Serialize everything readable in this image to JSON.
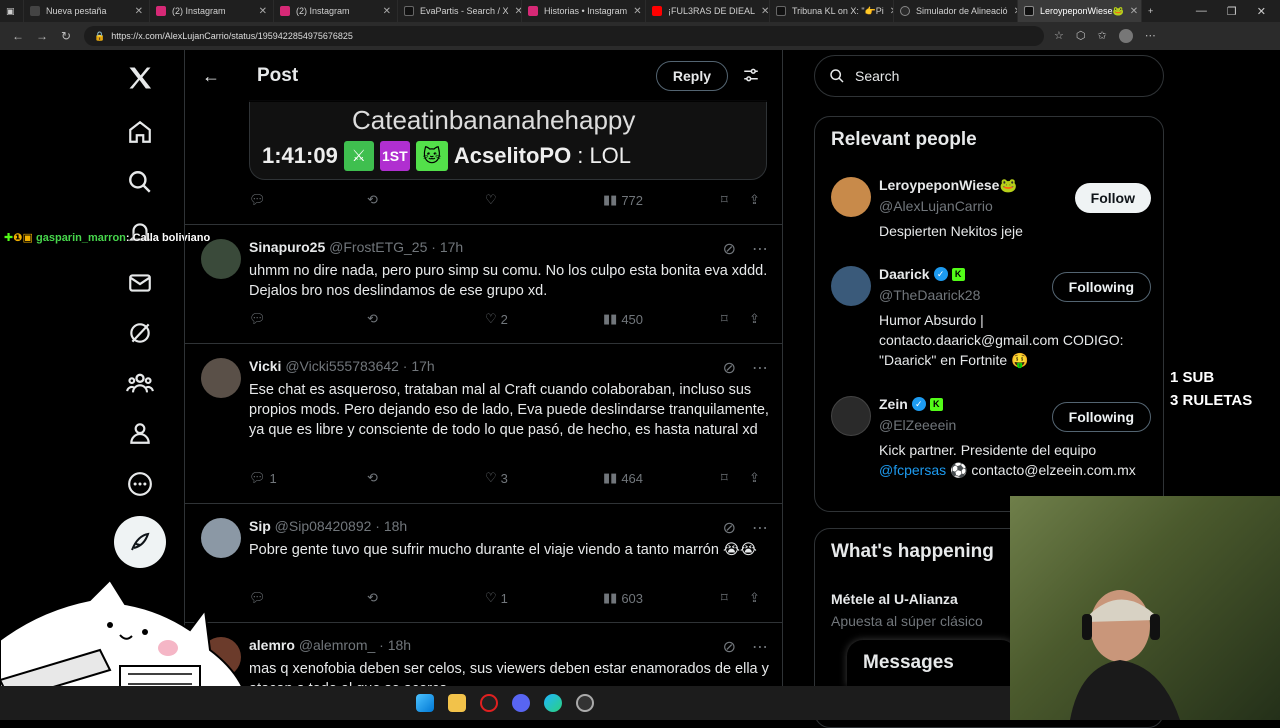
{
  "browser": {
    "tabs": [
      {
        "title": "Nueva pestaña",
        "color": "#444"
      },
      {
        "title": "(2) Instagram",
        "color": "#d62976"
      },
      {
        "title": "(2) Instagram",
        "color": "#d62976"
      },
      {
        "title": "EvaPartis - Search / X",
        "color": "#111"
      },
      {
        "title": "Historias • Instagram",
        "color": "#d62976"
      },
      {
        "title": "¡FUL3RAS DE DIEAL",
        "color": "#ff0000"
      },
      {
        "title": "Tribuna KL on X: \"👉Pi",
        "color": "#111"
      },
      {
        "title": "Simulador de Alineació",
        "color": "#2a2a2a"
      },
      {
        "title": "LeroypeponWiese🐸",
        "color": "#111"
      }
    ],
    "url": "https://x.com/AlexLujanCarrio/status/1959422854975676825"
  },
  "overlay": {
    "chat_user": "gasparin_marron",
    "chat_message": ": Calla boliviano",
    "sub_line1": "1 SUB",
    "sub_line2": "3 RULETAS"
  },
  "header": {
    "title": "Post",
    "reply_label": "Reply"
  },
  "media": {
    "line1": "Cateatinbananahehappy",
    "time": "1:41:09",
    "rank": "1ST",
    "user": "AcselitoPO",
    "msg": ": LOL"
  },
  "media_actions": {
    "views": "772"
  },
  "tweets": [
    {
      "name": "Sinapuro25",
      "handle": "@FrostETG_25 · 17h",
      "text": "uhmm no dire nada, pero puro simp su comu. No los culpo esta bonita eva xddd. Dejalos bro nos deslindamos de ese grupo xd.",
      "replies": "",
      "likes": "2",
      "views": "450",
      "avatar": "#3a4a3a"
    },
    {
      "name": "Vicki",
      "handle": "@Vicki555783642 · 17h",
      "text": "Ese chat es asqueroso, trataban mal al Craft cuando colaboraban, incluso sus propios mods. Pero dejando eso de lado, Eva puede deslindarse tranquilamente, ya que es libre y consciente de todo lo que pasó, de hecho, es hasta natural xd",
      "replies": "1",
      "likes": "3",
      "views": "464",
      "avatar": "#5a5048"
    },
    {
      "name": "Sip",
      "handle": "@Sip08420892 · 18h",
      "text": "Pobre gente tuvo que sufrir mucho durante el viaje viendo a tanto marrón 😭😭",
      "replies": "",
      "likes": "1",
      "views": "603",
      "avatar": "#8b98a5"
    },
    {
      "name": "alemro",
      "handle": "@alemrom_ · 18h",
      "text": "mas q xenofobia deben ser celos, sus viewers deben estar enamorados de ella y atacan a todo el que se acerca",
      "replies": "",
      "likes": "",
      "views": "",
      "avatar": "#6b3b2b"
    }
  ],
  "search": {
    "placeholder": "Search"
  },
  "relevant": {
    "title": "Relevant people",
    "people": [
      {
        "name": "LeroypeponWiese🐸",
        "handle": "@AlexLujanCarrio",
        "bio": "Despierten Nekitos jeje",
        "button": "Follow",
        "avatar": "#c88a4a"
      },
      {
        "name": "Daarick",
        "handle": "@TheDaarick28",
        "bio": "Humor Absurdo | contacto.daarick@gmail.com CODIGO: \"Daarick\" en Fortnite 🤑",
        "button": "Following",
        "avatar": "#3a5a7a"
      },
      {
        "name": "Zein",
        "handle": "@ElZeeeein",
        "bio_pre": "Kick partner. Presidente del equipo ",
        "bio_link": "@fcpersas",
        "bio_post": " ⚽ contacto@elzeein.com.mx",
        "button": "Following",
        "avatar": "#2a2a2a"
      }
    ]
  },
  "happening": {
    "title": "What's happening",
    "trend_title": "Métele al U-Alianza",
    "trend_sub": "Apuesta al súper clásico"
  },
  "messages": {
    "label": "Messages"
  },
  "colors": {
    "accent": "#1d9bf0",
    "border": "#2f3336",
    "kick": "#53fc18"
  }
}
